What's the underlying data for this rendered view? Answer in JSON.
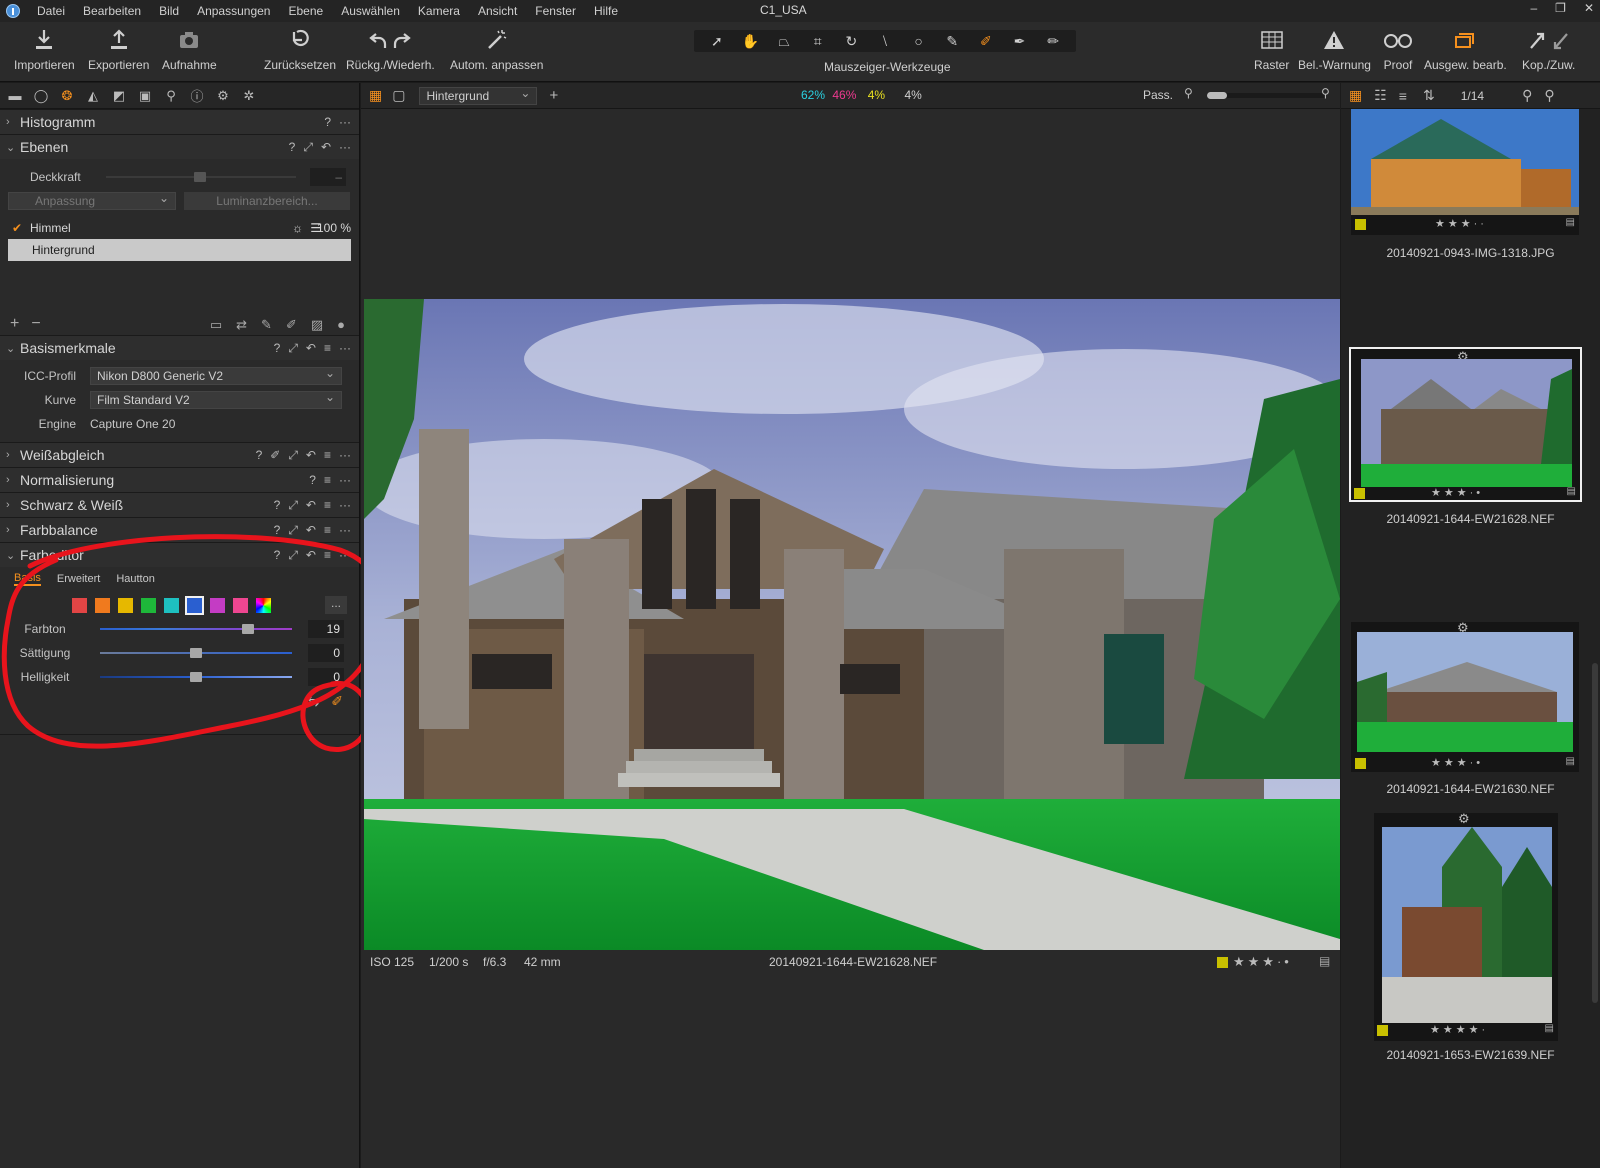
{
  "window": {
    "title": "C1_USA",
    "controls": [
      "–",
      "❐",
      "✕"
    ]
  },
  "menu": [
    "Datei",
    "Bearbeiten",
    "Bild",
    "Anpassungen",
    "Ebene",
    "Auswählen",
    "Kamera",
    "Ansicht",
    "Fenster",
    "Hilfe"
  ],
  "toolbar": {
    "import": "Importieren",
    "export": "Exportieren",
    "capture": "Aufnahme",
    "reset": "Zurücksetzen",
    "undo_redo": "Rückg./Wiederh.",
    "auto_adjust": "Autom. anpassen",
    "cursor_tools_label": "Mauszeiger-Werkzeuge",
    "grid": "Raster",
    "exposure_warning": "Bel.-Warnung",
    "proof": "Proof",
    "edit_selected": "Ausgew. bearb.",
    "copy_apply": "Kop./Zuw."
  },
  "left_panel": {
    "histogram": {
      "title": "Histogramm"
    },
    "layers": {
      "title": "Ebenen",
      "opacity_label": "Deckkraft",
      "opacity_value": "–",
      "adjustment_select": "Anpassung",
      "luminance_button": "Luminanzbereich...",
      "items": [
        {
          "name": "Himmel",
          "opacity": "100 %"
        },
        {
          "name": "Hintergrund"
        }
      ]
    },
    "basic": {
      "title": "Basismerkmale",
      "icc_label": "ICC-Profil",
      "icc_value": "Nikon D800 Generic V2",
      "curve_label": "Kurve",
      "curve_value": "Film Standard V2",
      "engine_label": "Engine",
      "engine_value": "Capture One 20"
    },
    "white_balance": {
      "title": "Weißabgleich"
    },
    "normalization": {
      "title": "Normalisierung"
    },
    "bw": {
      "title": "Schwarz & Weiß"
    },
    "color_balance": {
      "title": "Farbbalance"
    },
    "color_editor": {
      "title": "Farbeditor",
      "tabs": [
        "Basis",
        "Erweitert",
        "Hautton"
      ],
      "more_button": "...",
      "swatch_colors": [
        "#e24545",
        "#f07a1e",
        "#e6b800",
        "#1eb83a",
        "#1ec0c0",
        "#2a5fd0",
        "#c43cc4",
        "#ee4690"
      ],
      "selected_swatch_index": 5,
      "hue_label": "Farbton",
      "hue_value": "19",
      "hue_position": 0.79,
      "sat_label": "Sättigung",
      "sat_value": "0",
      "sat_position": 0.5,
      "light_label": "Helligkeit",
      "light_value": "0",
      "light_position": 0.5
    }
  },
  "viewer": {
    "layer_select": "Hintergrund",
    "percent": {
      "cyan": "62%",
      "magenta": "46%",
      "yellow": "4%",
      "gray": "4%"
    },
    "fit": "Pass.",
    "info": {
      "iso": "ISO 125",
      "shutter": "1/200 s",
      "aperture": "f/6.3",
      "focal": "42 mm",
      "filename": "20140921-1644-EW21628.NEF"
    },
    "rating": 3
  },
  "browser": {
    "count": "1/14",
    "thumbs": [
      {
        "name": "20140921-0943-IMG-1318.JPG",
        "rating": 3
      },
      {
        "name": "20140921-1644-EW21628.NEF",
        "rating": 3,
        "selected": true
      },
      {
        "name": "20140921-1644-EW21630.NEF",
        "rating": 3
      },
      {
        "name": "20140921-1653-EW21639.NEF",
        "rating": 4
      }
    ]
  },
  "colors": {
    "accent": "#f5901e",
    "annotation": "#e8141c",
    "label_yellow": "#c8c000"
  }
}
